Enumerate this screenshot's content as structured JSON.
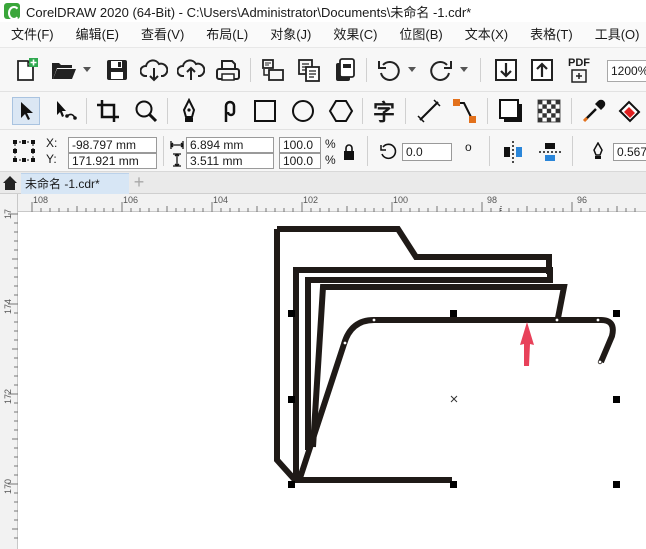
{
  "window": {
    "title": "CorelDRAW 2020 (64-Bit) - C:\\Users\\Administrator\\Documents\\未命名 -1.cdr*"
  },
  "menu": [
    "文件(F)",
    "编辑(E)",
    "查看(V)",
    "布局(L)",
    "对象(J)",
    "效果(C)",
    "位图(B)",
    "文本(X)",
    "表格(T)",
    "工具(O)"
  ],
  "toolbar": {
    "zoom": "1200%",
    "pdf_label": "PDF"
  },
  "toolbox": {
    "text_tool_glyph": "字"
  },
  "properties": {
    "x_label": "X:",
    "x_value": "-98.797 mm",
    "y_label": "Y:",
    "y_value": "171.921 mm",
    "width_value": "6.894 mm",
    "height_value": "3.511 mm",
    "scale_w": "100.0",
    "scale_h": "100.0",
    "percent": "%",
    "rotation": "0.0",
    "degree": "o",
    "outline_width": "0.567"
  },
  "tabs": {
    "document": "未命名 -1.cdr*",
    "add": "+"
  },
  "rulers": {
    "horizontal": [
      "108",
      "106",
      "104",
      "102",
      "100",
      "98",
      "96"
    ],
    "vertical": [
      "174",
      "172",
      "170"
    ],
    "corner": "17"
  }
}
